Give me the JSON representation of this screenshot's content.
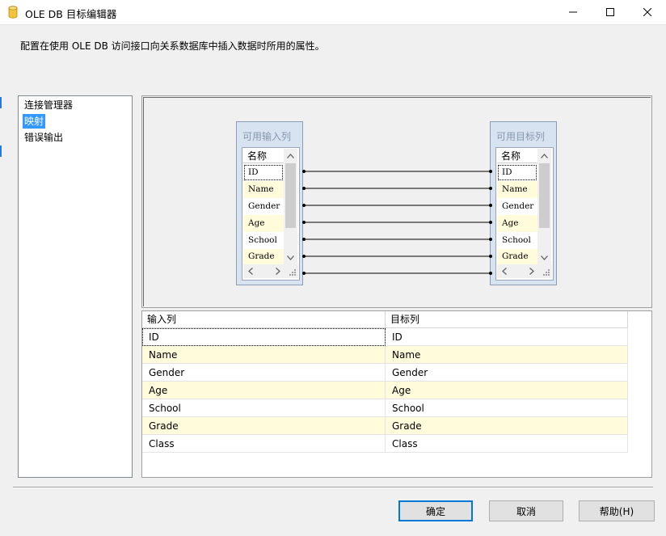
{
  "window": {
    "title": "OLE DB 目标编辑器",
    "description": "配置在使用 OLE DB 访问接口向关系数据库中插入数据时所用的属性。"
  },
  "nav": {
    "items": [
      {
        "label": "连接管理器",
        "selected": false
      },
      {
        "label": "映射",
        "selected": true
      },
      {
        "label": "错误输出",
        "selected": false
      }
    ]
  },
  "mapping": {
    "input_box": {
      "title": "可用输入列",
      "header": "名称",
      "rows": [
        "ID",
        "Name",
        "Gender",
        "Age",
        "School",
        "Grade"
      ]
    },
    "target_box": {
      "title": "可用目标列",
      "header": "名称",
      "rows": [
        "ID",
        "Name",
        "Gender",
        "Age",
        "School",
        "Grade"
      ]
    }
  },
  "grid": {
    "headers": {
      "input": "输入列",
      "target": "目标列"
    },
    "rows": [
      {
        "input": "ID",
        "target": "ID"
      },
      {
        "input": "Name",
        "target": "Name"
      },
      {
        "input": "Gender",
        "target": "Gender"
      },
      {
        "input": "Age",
        "target": "Age"
      },
      {
        "input": "School",
        "target": "School"
      },
      {
        "input": "Grade",
        "target": "Grade"
      },
      {
        "input": "Class",
        "target": "Class"
      }
    ]
  },
  "buttons": {
    "ok": "确定",
    "cancel": "取消",
    "help": "帮助(H)"
  },
  "colors": {
    "selection": "#3399ff",
    "alt_row": "#fffbdb",
    "column_box": "#d7e3f1",
    "default_button_border": "#0078d7"
  }
}
